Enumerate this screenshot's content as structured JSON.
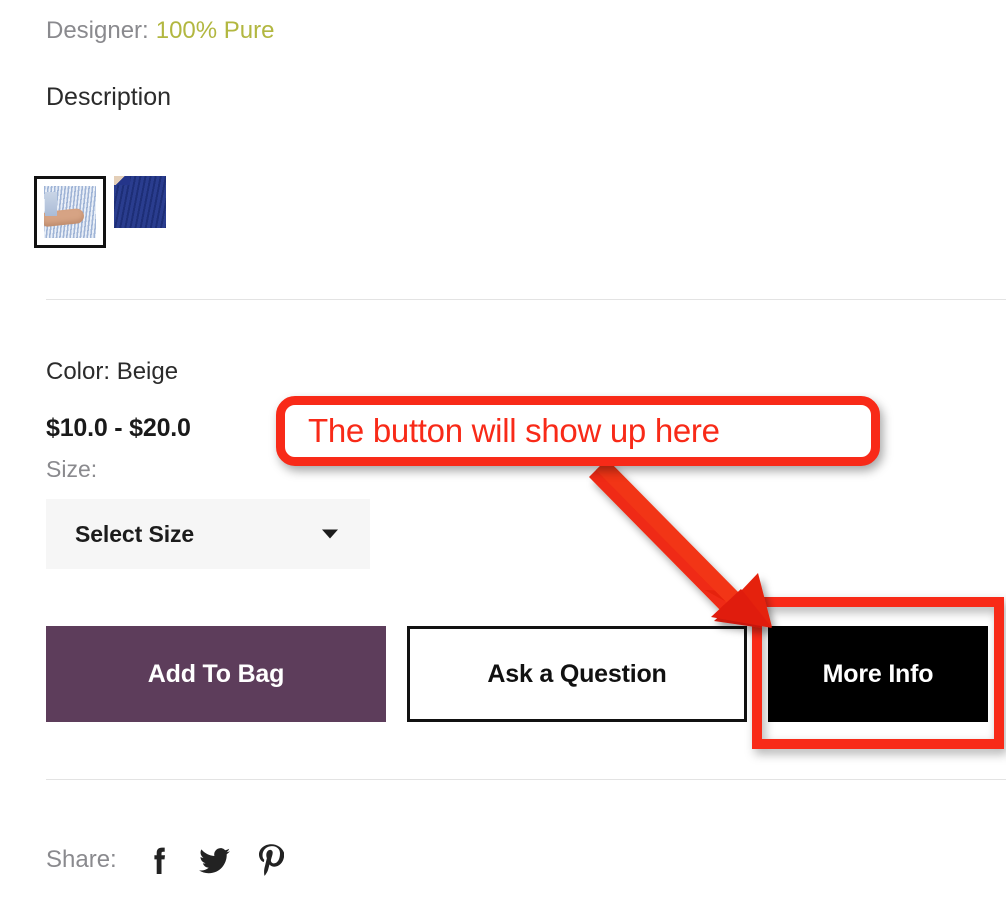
{
  "product": {
    "designer_label": "Designer:",
    "designer_name": "100% Pure",
    "description_heading": "Description",
    "color_line": "Color: Beige",
    "price_range": "$10.0 - $20.0",
    "size_label": "Size:"
  },
  "thumbnails": [
    {
      "name": "striped-shirt-thumbnail",
      "selected": true
    },
    {
      "name": "navy-dress-thumbnail",
      "selected": false
    }
  ],
  "size_select": {
    "selected_value": "Select Size",
    "caret_icon": "chevron-down-icon"
  },
  "buttons": {
    "add_to_bag": "Add To Bag",
    "ask_a_question": "Ask a Question",
    "more_info": "More Info"
  },
  "share": {
    "label": "Share:",
    "icons": [
      {
        "name": "facebook-icon",
        "glyph": "f"
      },
      {
        "name": "twitter-icon",
        "glyph": "bird"
      },
      {
        "name": "pinterest-icon",
        "glyph": "P"
      }
    ]
  },
  "annotation": {
    "callout_text": "The button will show up here",
    "target": "More Info",
    "color": "#f82a18"
  },
  "colors": {
    "designer_link": "#b2b740",
    "add_to_bag_bg": "#5d3d5b",
    "more_info_bg": "#000000",
    "annotation_red": "#f82a18",
    "select_bg": "#f6f6f6",
    "muted_text": "#8a8a8e",
    "divider": "#e3e3e3"
  }
}
